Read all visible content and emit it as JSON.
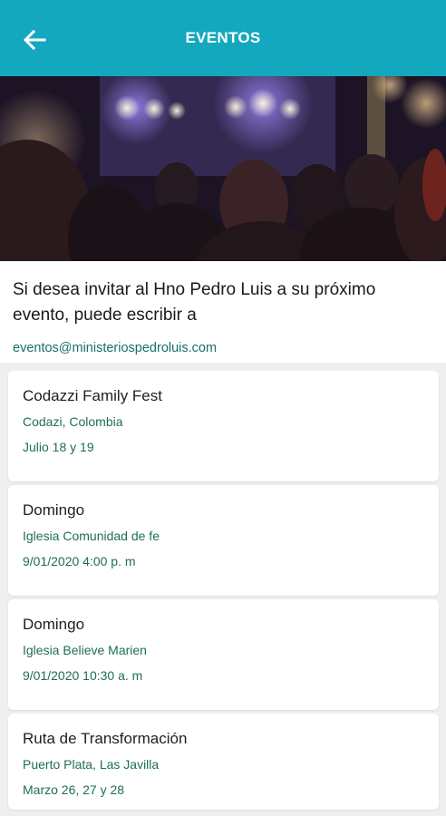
{
  "appbar": {
    "title": "EVENTOS",
    "back_icon": "arrow-left-icon",
    "color": "#14a8bf"
  },
  "hero": {
    "alt": "concert-crowd-image"
  },
  "intro": {
    "text": "Si desea invitar al Hno Pedro Luis a su próximo evento, puede escribir a",
    "email": "eventos@ministeriospedroluis.com"
  },
  "events": [
    {
      "title": "Codazzi Family Fest",
      "place": "Codazi, Colombia",
      "date": "Julio 18 y 19"
    },
    {
      "title": "Domingo",
      "place": "Iglesia Comunidad de fe",
      "date": "9/01/2020 4:00 p. m"
    },
    {
      "title": "Domingo",
      "place": "Iglesia Believe Marien",
      "date": "9/01/2020 10:30 a. m"
    },
    {
      "title": "Ruta de Transformación",
      "place": "Puerto Plata, Las Javilla",
      "date": "Marzo 26, 27 y 28"
    }
  ],
  "colors": {
    "accent": "#14a8bf",
    "link": "#15706c",
    "detail": "#1f6e56"
  }
}
